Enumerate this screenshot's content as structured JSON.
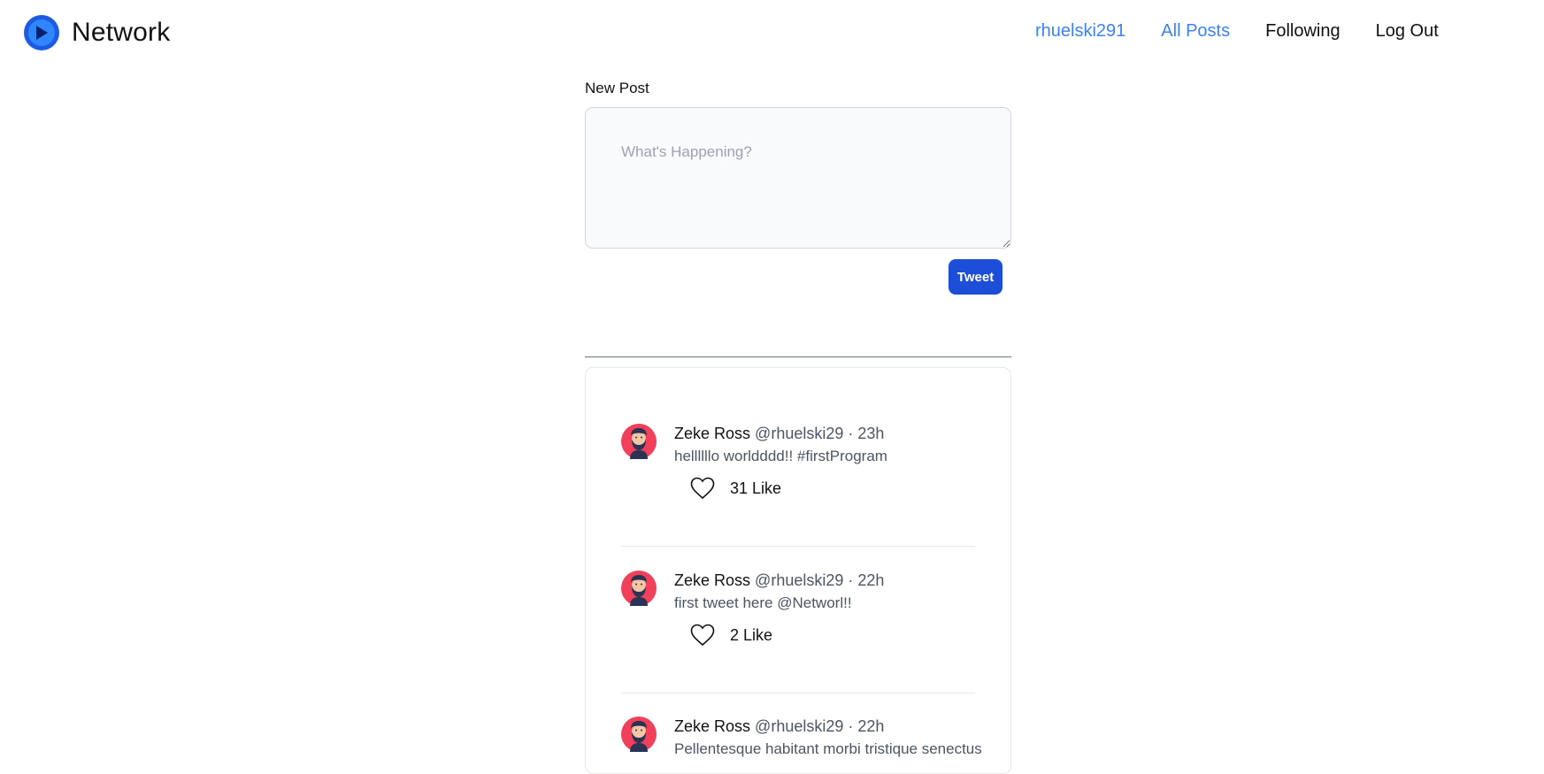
{
  "nav": {
    "brand": "Network",
    "links": {
      "username": "rhuelski291",
      "all_posts": "All Posts",
      "following": "Following",
      "logout": "Log Out"
    },
    "accent_color": "#3b82f6"
  },
  "composer": {
    "label": "New Post",
    "placeholder": "What's Happening?",
    "value": "",
    "submit_label": "Tweet",
    "submit_color": "#1d4ed8"
  },
  "feed": {
    "posts": [
      {
        "name": "Zeke Ross",
        "handle": "@rhuelski29",
        "separator": "·",
        "time": "23h",
        "body": "hellllllo worldddd!! #firstProgram",
        "likes": "31 Like",
        "avatar_icon": "bearded-man-avatar-icon",
        "like_icon": "heart-outline-icon"
      },
      {
        "name": "Zeke Ross",
        "handle": "@rhuelski29",
        "separator": "·",
        "time": "22h",
        "body": "first tweet here @Networl!!",
        "likes": "2 Like",
        "avatar_icon": "bearded-man-avatar-icon",
        "like_icon": "heart-outline-icon"
      },
      {
        "name": "Zeke Ross",
        "handle": "@rhuelski29",
        "separator": "·",
        "time": "22h",
        "body": "Pellentesque habitant morbi tristique senectus",
        "likes": "",
        "avatar_icon": "bearded-man-avatar-icon",
        "like_icon": "heart-outline-icon"
      }
    ]
  }
}
